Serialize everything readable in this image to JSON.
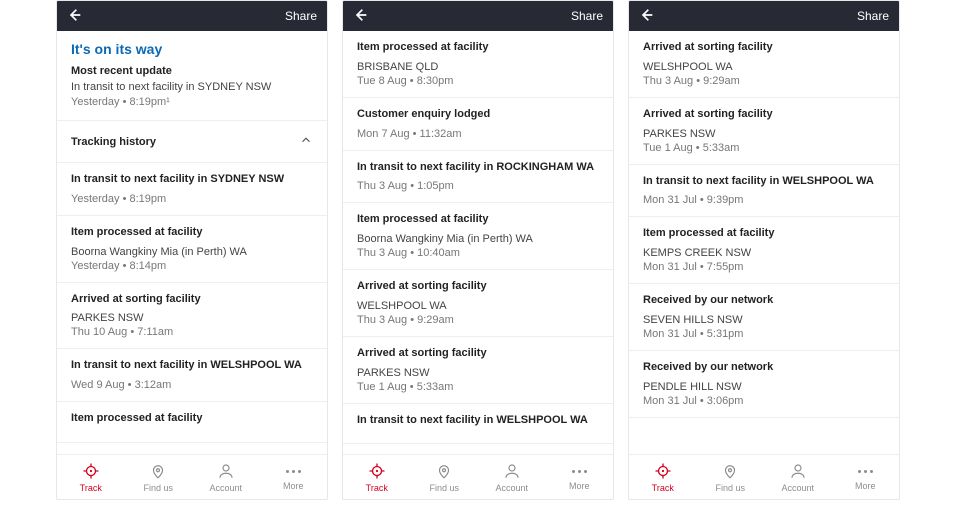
{
  "topbar": {
    "share": "Share"
  },
  "screens": [
    {
      "status": {
        "title": "It's on its way",
        "sub": "Most recent update",
        "line": "In transit to next facility in SYDNEY NSW",
        "time": "Yesterday • 8:19pm¹"
      },
      "history_label": "Tracking history",
      "events": [
        {
          "title": "In transit to next facility in SYDNEY NSW",
          "loc": "",
          "time": "Yesterday • 8:19pm"
        },
        {
          "title": "Item processed at facility",
          "loc": "Boorna Wangkiny Mia (in Perth) WA",
          "time": "Yesterday • 8:14pm"
        },
        {
          "title": "Arrived at sorting facility",
          "loc": "PARKES NSW",
          "time": "Thu 10 Aug • 7:11am"
        },
        {
          "title": "In transit to next facility in WELSHPOOL WA",
          "loc": "",
          "time": "Wed 9 Aug • 3:12am"
        },
        {
          "title": "Item processed at facility",
          "loc": "",
          "time": ""
        }
      ]
    },
    {
      "events": [
        {
          "title": "Item processed at facility",
          "loc": "BRISBANE QLD",
          "time": "Tue 8 Aug • 8:30pm"
        },
        {
          "title": "Customer enquiry lodged",
          "loc": "",
          "time": "Mon 7 Aug • 11:32am"
        },
        {
          "title": "In transit to next facility in ROCKINGHAM WA",
          "loc": "",
          "time": "Thu 3 Aug • 1:05pm"
        },
        {
          "title": "Item processed at facility",
          "loc": "Boorna Wangkiny Mia (in Perth) WA",
          "time": "Thu 3 Aug • 10:40am"
        },
        {
          "title": "Arrived at sorting facility",
          "loc": "WELSHPOOL WA",
          "time": "Thu 3 Aug • 9:29am"
        },
        {
          "title": "Arrived at sorting facility",
          "loc": "PARKES NSW",
          "time": "Tue 1 Aug • 5:33am"
        },
        {
          "title": "In transit to next facility in WELSHPOOL WA",
          "loc": "",
          "time": ""
        }
      ]
    },
    {
      "events": [
        {
          "title": "Arrived at sorting facility",
          "loc": "WELSHPOOL WA",
          "time": "Thu 3 Aug • 9:29am"
        },
        {
          "title": "Arrived at sorting facility",
          "loc": "PARKES NSW",
          "time": "Tue 1 Aug • 5:33am"
        },
        {
          "title": "In transit to next facility in WELSHPOOL WA",
          "loc": "",
          "time": "Mon 31 Jul • 9:39pm"
        },
        {
          "title": "Item processed at facility",
          "loc": "KEMPS CREEK NSW",
          "time": "Mon 31 Jul • 7:55pm"
        },
        {
          "title": "Received by our network",
          "loc": "SEVEN HILLS NSW",
          "time": "Mon 31 Jul • 5:31pm"
        },
        {
          "title": "Received by our network",
          "loc": "PENDLE HILL NSW",
          "time": "Mon 31 Jul • 3:06pm"
        }
      ]
    }
  ],
  "tabs": [
    {
      "id": "track",
      "label": "Track",
      "active": true
    },
    {
      "id": "findus",
      "label": "Find us"
    },
    {
      "id": "account",
      "label": "Account"
    },
    {
      "id": "more",
      "label": "More"
    }
  ]
}
